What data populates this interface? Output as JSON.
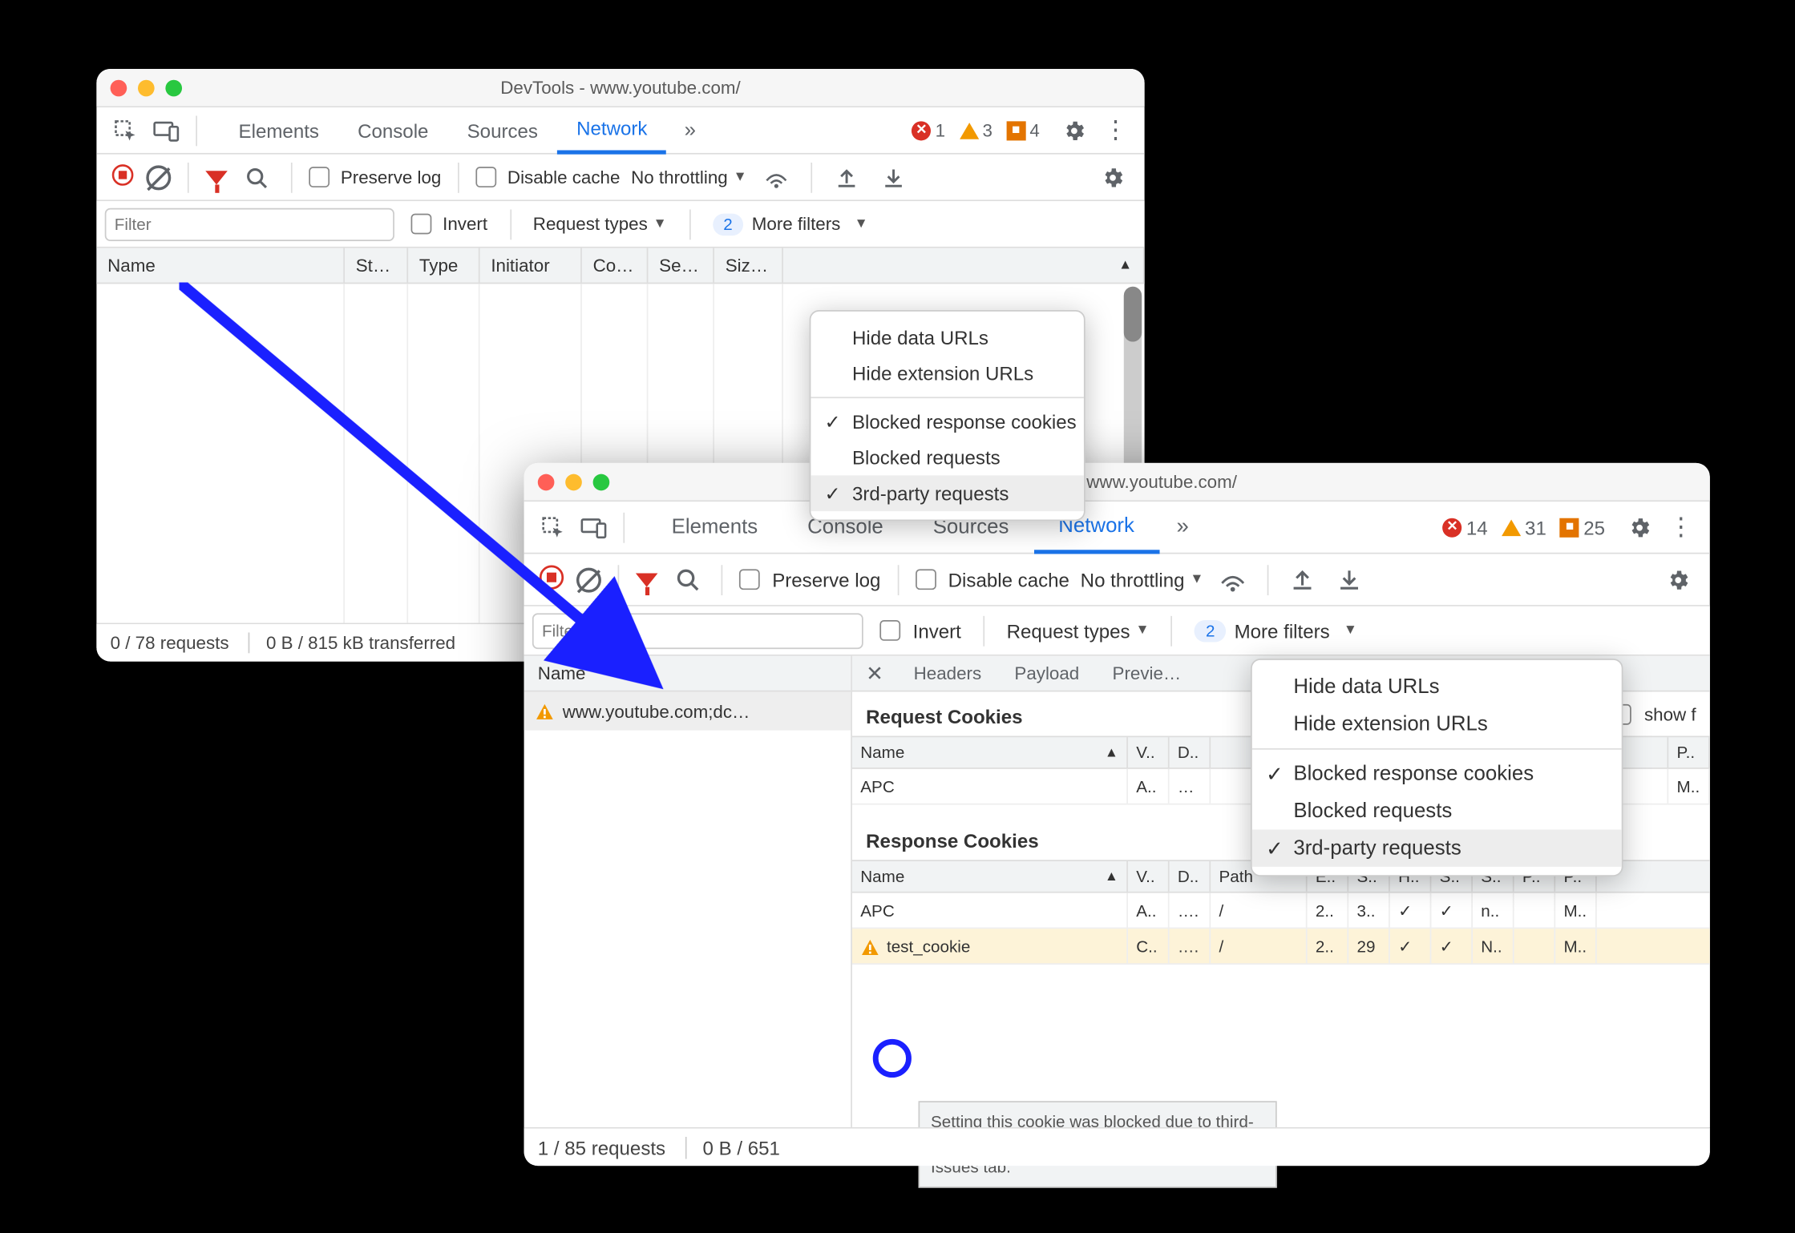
{
  "win1": {
    "title": "DevTools - www.youtube.com/",
    "tabs": [
      "Elements",
      "Console",
      "Sources",
      "Network"
    ],
    "active_tab": "Network",
    "issues": {
      "errors": 1,
      "warnings": 3,
      "info": 4
    },
    "controls": {
      "preserve_log": "Preserve log",
      "disable_cache": "Disable cache",
      "throttling": "No throttling"
    },
    "filter": {
      "placeholder": "Filter",
      "invert": "Invert",
      "request_types": "Request types",
      "more_filters": "More filters",
      "badge": "2"
    },
    "columns": [
      "Name",
      "St…",
      "Type",
      "Initiator",
      "Co…",
      "Se…",
      "Siz…"
    ],
    "menu": {
      "items": [
        {
          "label": "Hide data URLs",
          "checked": false
        },
        {
          "label": "Hide extension URLs",
          "checked": false
        }
      ],
      "items2": [
        {
          "label": "Blocked response cookies",
          "checked": true
        },
        {
          "label": "Blocked requests",
          "checked": false
        },
        {
          "label": "3rd-party requests",
          "checked": true,
          "hover": true
        }
      ]
    },
    "status": {
      "requests": "0 / 78 requests",
      "transfer": "0 B / 815 kB transferred"
    }
  },
  "win2": {
    "title": "DevTools - www.youtube.com/",
    "tabs": [
      "Elements",
      "Console",
      "Sources",
      "Network"
    ],
    "active_tab": "Network",
    "issues": {
      "errors": 14,
      "warnings": 31,
      "info": 25
    },
    "controls": {
      "preserve_log": "Preserve log",
      "disable_cache": "Disable cache",
      "throttling": "No throttling"
    },
    "filter": {
      "placeholder": "Filter",
      "invert": "Invert",
      "request_types": "Request types",
      "more_filters": "More filters",
      "badge": "2"
    },
    "name_header": "Name",
    "selected_request": "www.youtube.com;dc…",
    "detail_tabs": [
      "Headers",
      "Payload",
      "Previe…"
    ],
    "request_cookies": {
      "title": "Request Cookies",
      "show_filtered": "show f",
      "headers": [
        "Name",
        "V..",
        "D..",
        "",
        "",
        "",
        "",
        "",
        "",
        "P.."
      ],
      "rows": [
        {
          "name": "APC",
          "v": "A..",
          "d": "…",
          "p": "M.."
        }
      ]
    },
    "response_cookies": {
      "title": "Response Cookies",
      "headers": [
        "Name",
        "V..",
        "D..",
        "Path",
        "E..",
        "S..",
        "H..",
        "S..",
        "S..",
        "P..",
        "P.."
      ],
      "rows": [
        {
          "name": "APC",
          "v": "A..",
          "d": "….",
          "path": "/",
          "e": "2..",
          "s1": "3..",
          "h": "✓",
          "s2": "✓",
          "s3": "n..",
          "p1": "",
          "p2": "M.."
        },
        {
          "name": "test_cookie",
          "v": "C..",
          "d": "….",
          "path": "/",
          "e": "2..",
          "s1": "29",
          "h": "✓",
          "s2": "✓",
          "s3": "N..",
          "p1": "",
          "p2": "M..",
          "warn": true
        }
      ]
    },
    "tooltip": "Setting this cookie was blocked due to third-party cookie phaseout. Learn more in the Issues tab.",
    "menu": {
      "items": [
        {
          "label": "Hide data URLs",
          "checked": false
        },
        {
          "label": "Hide extension URLs",
          "checked": false
        }
      ],
      "items2": [
        {
          "label": "Blocked response cookies",
          "checked": true
        },
        {
          "label": "Blocked requests",
          "checked": false
        },
        {
          "label": "3rd-party requests",
          "checked": true,
          "hover": true
        }
      ]
    },
    "status": {
      "requests": "1 / 85 requests",
      "transfer": "0 B / 651"
    }
  }
}
